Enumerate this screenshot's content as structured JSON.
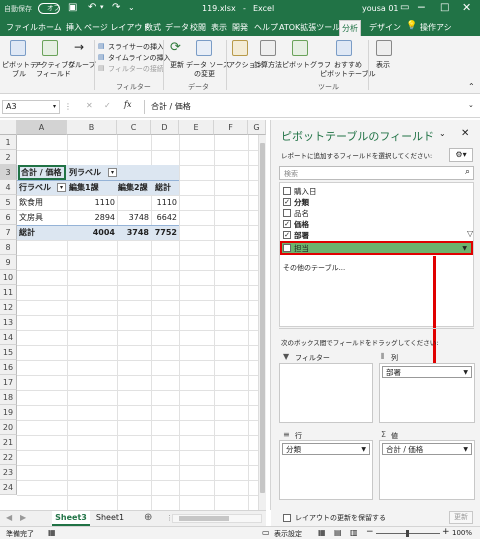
{
  "titlebar": {
    "autosave": "自動保存",
    "autosave_state": "オフ",
    "filename": "119.xlsx",
    "separator": "-",
    "app": "Excel",
    "user": "yousa 01"
  },
  "tabs": [
    "ファイル",
    "ホーム",
    "挿入",
    "ページ レイアウト",
    "数式",
    "データ",
    "校閲",
    "表示",
    "開発",
    "ヘルプ",
    "ATOK拡張ツール",
    "分析",
    "デザイン"
  ],
  "tab_help": "操作アシ",
  "ribbon": {
    "pivot_table": "ピボットテー",
    "pivot_table2": "ブル",
    "active_field": "アクティブな",
    "active_field2": "フィールド",
    "group": "グループ",
    "slicer": "スライサーの挿入",
    "timeline": "タイムラインの挿入",
    "filter_conn": "フィルターの接続",
    "group_filter": "フィルター",
    "refresh": "更新",
    "change_source": "データ ソース",
    "change_source2": "の変更",
    "group_data": "データ",
    "actions": "アクション",
    "calc": "計算方法",
    "pivot_chart": "ピボットグラフ",
    "recommended": "おすすめ",
    "recommended2": "ピボットテーブル",
    "group_tools": "ツール",
    "show": "表示"
  },
  "formula_bar": {
    "name_box": "A3",
    "fx": "fx",
    "content": "合計 / 価格"
  },
  "columns": [
    "A",
    "B",
    "C",
    "D",
    "E",
    "F",
    "G"
  ],
  "rows": [
    "1",
    "2",
    "3",
    "4",
    "5",
    "6",
    "7",
    "8",
    "9",
    "10",
    "11",
    "12",
    "13",
    "14",
    "15",
    "16",
    "17",
    "18",
    "19",
    "20",
    "21",
    "22",
    "23",
    "24"
  ],
  "pivot": {
    "a3": "合計 / 価格",
    "b3": "列ラベル",
    "a4": "行ラベル",
    "b4": "編集1課",
    "c4": "編集2課",
    "d4": "総計",
    "a5": "飲食用",
    "b5": "1110",
    "d5": "1110",
    "a6": "文房具",
    "b6": "2894",
    "c6": "3748",
    "d6": "6642",
    "a7": "総計",
    "b7": "4004",
    "c7": "3748",
    "d7": "7752"
  },
  "pane": {
    "title": "ピボットテーブルのフィールド",
    "subtitle": "レポートに追加するフィールドを選択してください:",
    "search_placeholder": "検索",
    "fields": [
      {
        "label": "購入日",
        "checked": false
      },
      {
        "label": "分類",
        "checked": true
      },
      {
        "label": "品名",
        "checked": false
      },
      {
        "label": "価格",
        "checked": true
      },
      {
        "label": "部署",
        "checked": true
      },
      {
        "label": "担当",
        "checked": false
      }
    ],
    "other_tables": "その他のテーブル...",
    "drag_text": "次のボックス間でフィールドをドラッグしてください:",
    "filter_label": "フィルター",
    "column_label": "列",
    "row_label": "行",
    "value_label": "値",
    "column_field": "部署",
    "row_field": "分類",
    "value_field": "合計 / 価格",
    "defer": "レイアウトの更新を保留する",
    "update": "更新"
  },
  "sheet_tabs": [
    "Sheet3",
    "Sheet1"
  ],
  "status": {
    "ready": "準備完了",
    "display_settings": "表示設定",
    "zoom": "100%"
  },
  "colors": {
    "excel_green": "#217346",
    "highlight_red": "#e00000",
    "highlight_green": "#6db36d",
    "pivot_header": "#dce6f1"
  }
}
